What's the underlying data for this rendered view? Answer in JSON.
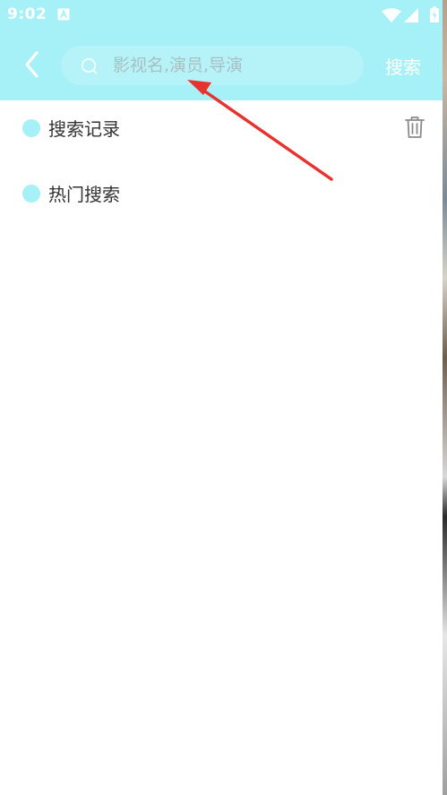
{
  "status_bar": {
    "time": "9:02"
  },
  "header": {
    "search_placeholder": "影视名,演员,导演",
    "search_input_value": "",
    "search_button_label": "搜索"
  },
  "sections": {
    "history_title": "搜索记录",
    "hot_title": "热门搜索"
  },
  "colors": {
    "header_background": "#a6f0f7",
    "search_box_background": "#b5f3f9",
    "accent_dot": "#a6f0f7",
    "annotation_arrow": "#e8322d",
    "icon_gray": "#8a8a8a"
  },
  "icons": {
    "back": "chevron-left-icon",
    "search": "magnifier-icon",
    "delete_history": "trash-icon",
    "wifi": "wifi-icon",
    "signal": "signal-icon",
    "battery": "battery-icon"
  }
}
